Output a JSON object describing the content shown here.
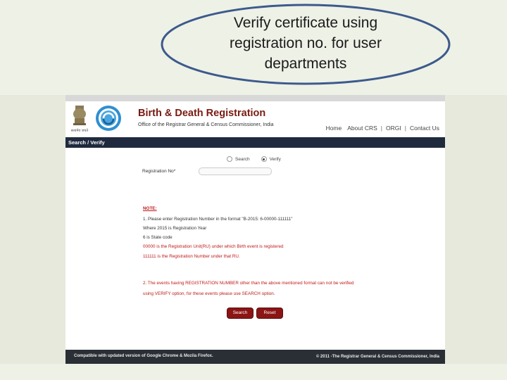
{
  "slide": {
    "callout_lines": [
      "Verify certificate using",
      "registration no. for user",
      "departments"
    ],
    "colors": {
      "ellipse_stroke": "#3c5a8c",
      "background": "#eef1e6"
    }
  },
  "site": {
    "title": "Birth & Death Registration",
    "subtitle": "Office of the Registrar General & Census Commissioner, India",
    "emblem_caption": "सत्यमेव जयते",
    "nav": [
      "Home",
      "About CRS",
      "ORGI",
      "Contact Us"
    ],
    "section_title": "Search / Verify",
    "radio": {
      "search_label": "Search",
      "verify_label": "Verify",
      "selected": "Verify"
    },
    "reg_label": "Registration No*",
    "note": {
      "title": "NOTE:",
      "line1": "1. Please enter Registration Number in the format \"B-2015: 6-00000-111111\"",
      "line2": "Where 2015 is Registration Year",
      "line3": "6 is State code",
      "line4": "00000 is the Registration Unit(RU) under which Birth event is registered",
      "line5": "111111 is the Registration Number under that RU.",
      "line6": "2. The events having REGISTRATION NUMBER other than the above mentioned format can not be verified",
      "line7": "using VERIFY option, for these events please use SEARCH option."
    },
    "buttons": {
      "search": "Search",
      "reset": "Reset"
    },
    "footer": {
      "left": "Compatible with updated version of Google Chrome & Mozila Firefox.",
      "right": "© 2011 -The Registrar General & Census Commissioner, India"
    },
    "colors": {
      "title": "#7a1a10",
      "section_bar": "#1f2a3e",
      "button": "#8b1414",
      "note_red": "#c01818",
      "footer": "#2a2e35"
    }
  }
}
